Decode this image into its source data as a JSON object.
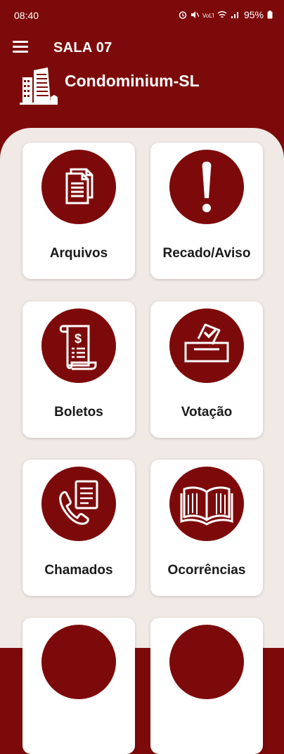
{
  "status_bar": {
    "time": "08:40",
    "battery": "95%"
  },
  "app_bar": {
    "room_title": "SALA 07"
  },
  "brand": {
    "name": "Condominium-SL"
  },
  "menu": [
    {
      "label": "Arquivos",
      "icon": "documents-icon"
    },
    {
      "label": "Recado/Aviso",
      "icon": "exclamation-icon"
    },
    {
      "label": "Boletos",
      "icon": "receipt-icon"
    },
    {
      "label": "Votação",
      "icon": "ballot-box-icon"
    },
    {
      "label": "Chamados",
      "icon": "phone-call-icon"
    },
    {
      "label": "Ocorrências",
      "icon": "open-book-icon"
    }
  ],
  "colors": {
    "primary": "#7d0a0a",
    "background": "#f1e9e6",
    "card": "#ffffff"
  }
}
